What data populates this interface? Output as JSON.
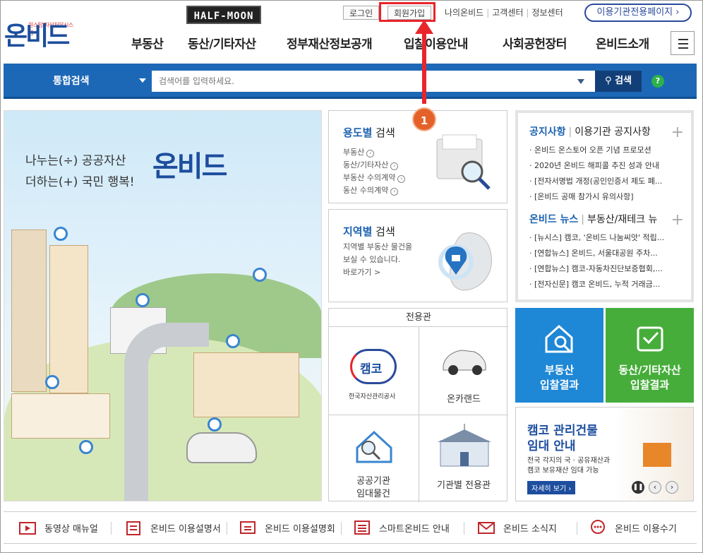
{
  "header": {
    "logo_tag": "원스탑 자산처분시스템",
    "logo_text": "온비드",
    "badge": "HALF-MOON",
    "login": "로그인",
    "signup": "회원가입",
    "util_links": [
      "나의온비드",
      "고객센터",
      "정보센터"
    ],
    "dedicated_page": "이용기관전용페이지 ›"
  },
  "gnb": [
    "부동산",
    "동산/기타자산",
    "정부재산정보공개",
    "입찰이용안내",
    "사회공헌장터",
    "온비드소개"
  ],
  "search": {
    "category": "통합검색",
    "placeholder": "검색어를 입력하세요.",
    "button": "검색",
    "help": "?"
  },
  "annotation": {
    "number": "1"
  },
  "hero": {
    "line1": "나누는(÷) 공공자산",
    "line2": "더하는(+) 국민 행복!",
    "logo": "온비드"
  },
  "usage_search": {
    "title_b": "용도별",
    "title": " 검색",
    "items": [
      "부동산",
      "동산/기타자산",
      "부동산 수의계약",
      "동산 수의계약"
    ]
  },
  "region_search": {
    "title_b": "지역별",
    "title": " 검색",
    "desc1": "지역별 부동산 물건을",
    "desc2": "보실 수 있습니다.",
    "more": "바로가기 >"
  },
  "dedicated": {
    "title": "전용관",
    "kamco_name": "캠코",
    "kamco_sub": "한국자산관리공사",
    "oncar": "온카랜드",
    "public_rent1": "공공기관",
    "public_rent2": "임대물건",
    "agency": "기관별 전용관"
  },
  "notice": {
    "title1": "공지사항",
    "title1b": "이용기관 공지사항",
    "items1": [
      "· 온비드 온스토어 오픈 기념 프로모션",
      "· 2020년 온비드 해피콜 추진 성과 안내",
      "· [전자서명법 개정(공인인증서 제도 폐...",
      "· [온비드 공매 참가시 유의사항]"
    ],
    "title2": "온비드 뉴스",
    "title2b": "부동산/재테크 뉴",
    "items2": [
      "· [뉴시스] 캠코, '온비드 나눔씨앗' 적립...",
      "· [연합뉴스] 온비드, 서울대공원 주차...",
      "· [연합뉴스] 캠코-자동차진단보증협회,...",
      "· [전자신문] 캠코 온비드, 누적 거래금..."
    ]
  },
  "tiles": {
    "realestate1": "부동산",
    "realestate2": "입찰결과",
    "movable1": "동산/기타자산",
    "movable2": "입찰결과"
  },
  "banner": {
    "title1": "캠코 관리건물",
    "title2": "임대 안내",
    "desc1": "전국 각지의 국 · 공유재산과",
    "desc2": "캠코 보유재산 임대 가능",
    "more": "자세히 보기 ›"
  },
  "footer": [
    "동영상 매뉴얼",
    "온비드 이용설명서",
    "온비드 이용설명회",
    "스마트온비드 안내",
    "온비드 소식지",
    "온비드 이용수기"
  ],
  "colors": {
    "brand": "#1d4e9e",
    "search_bar": "#1d68b6",
    "tile_blue": "#1e87d6",
    "tile_green": "#46ad3a",
    "annotation": "#e8252b"
  }
}
